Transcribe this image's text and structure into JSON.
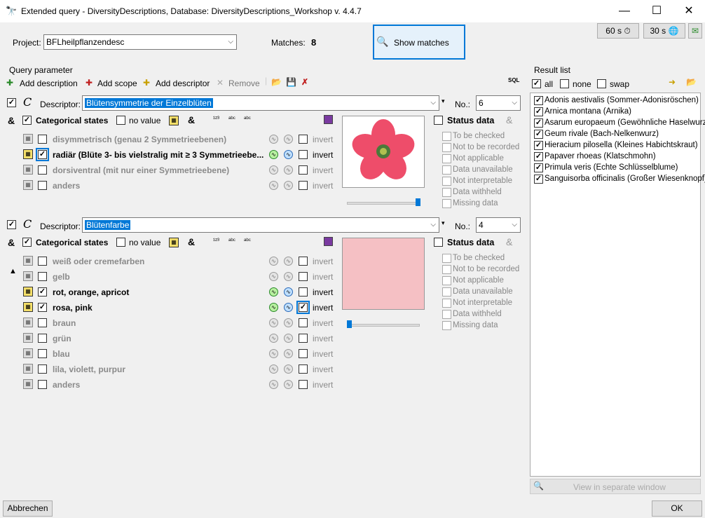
{
  "window": {
    "title": "Extended query - DiversityDescriptions,  Database: DiversityDescriptions_Workshop    v. 4.4.7",
    "controls": [
      "—",
      "☐",
      "✕"
    ],
    "timer_60": "60 s",
    "timer_30": "30 s"
  },
  "project": {
    "label": "Project:",
    "value": "BFLheilpflanzendesc"
  },
  "matches": {
    "label": "Matches:",
    "count": "8"
  },
  "show_matches": "Show matches",
  "query_group": "Query parameter",
  "toolbar": {
    "add_description": "Add description",
    "add_scope": "Add scope",
    "add_descriptor": "Add descriptor",
    "remove": "Remove"
  },
  "descriptors": [
    {
      "label": "Descriptor:",
      "value": "Blütensymmetrie der Einzelblüten",
      "no_label": "No.:",
      "no_value": "6",
      "header": {
        "title": "Categorical states",
        "no_value": "no value",
        "amp": "&"
      },
      "states": [
        {
          "label": "disymmetrisch (genau 2 Symmetrieebenen)",
          "checked": false,
          "active": false,
          "invert": false
        },
        {
          "label": "radiär (Blüte 3- bis vielstralig mit ≥ 3 Symmetrieebe...",
          "checked": true,
          "active": true,
          "invert": false
        },
        {
          "label": "dorsiventral (mit nur einer Symmetrieebene)",
          "checked": false,
          "active": false,
          "invert": false
        },
        {
          "label": "anders",
          "checked": false,
          "active": false,
          "invert": false
        }
      ],
      "invert_label": "invert",
      "status_title": "Status data",
      "status_items": [
        "To be checked",
        "Not to be recorded",
        "Not applicable",
        "Data unavailable",
        "Not interpretable",
        "Data withheld",
        "Missing data"
      ],
      "slider_value": 1.0
    },
    {
      "label": "Descriptor:",
      "value": "Blütenfarbe",
      "no_label": "No.:",
      "no_value": "4",
      "header": {
        "title": "Categorical states",
        "no_value": "no value",
        "amp": "&"
      },
      "states": [
        {
          "label": "weiß oder cremefarben",
          "checked": false,
          "active": false,
          "invert": false
        },
        {
          "label": "gelb",
          "checked": false,
          "active": false,
          "invert": false
        },
        {
          "label": "rot, orange, apricot",
          "checked": true,
          "active": true,
          "invert": false
        },
        {
          "label": "rosa, pink",
          "checked": true,
          "active": true,
          "invert": true
        },
        {
          "label": "braun",
          "checked": false,
          "active": false,
          "invert": false
        },
        {
          "label": "grün",
          "checked": false,
          "active": false,
          "invert": false
        },
        {
          "label": "blau",
          "checked": false,
          "active": false,
          "invert": false
        },
        {
          "label": "lila, violett, purpur",
          "checked": false,
          "active": false,
          "invert": false
        },
        {
          "label": "anders",
          "checked": false,
          "active": false,
          "invert": false
        }
      ],
      "invert_label": "invert",
      "status_title": "Status data",
      "status_items": [
        "To be checked",
        "Not to be recorded",
        "Not applicable",
        "Data unavailable",
        "Not interpretable",
        "Data withheld",
        "Missing data"
      ],
      "slider_value": 0.0
    }
  ],
  "result_list": {
    "title": "Result list",
    "all": "all",
    "none": "none",
    "swap": "swap",
    "items": [
      "Adonis aestivalis (Sommer-Adonisröschen)",
      "Arnica montana (Arnika)",
      "Asarum europaeum (Gewöhnliche Haselwurz)",
      "Geum rivale (Bach-Nelkenwurz)",
      "Hieracium pilosella (Kleines Habichtskraut)",
      "Papaver rhoeas (Klatschmohn)",
      "Primula veris (Echte Schlüsselblume)",
      "Sanguisorba officinalis (Großer Wiesenknopf)"
    ],
    "view_separate": "View in separate window"
  },
  "footer": {
    "cancel": "Abbrechen",
    "ok": "OK"
  },
  "colors": {
    "accent": "#0078d7",
    "swatch": "#f5c0c4",
    "flower": "#ee4d6a"
  }
}
